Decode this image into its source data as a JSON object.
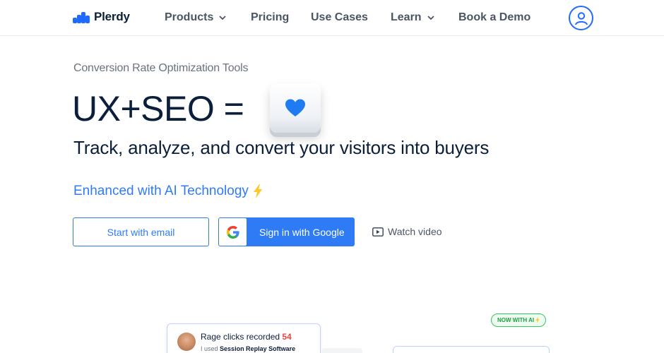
{
  "header": {
    "logo_text": "Plerdy",
    "nav": [
      {
        "label": "Products",
        "has_dropdown": true
      },
      {
        "label": "Pricing",
        "has_dropdown": false
      },
      {
        "label": "Use Cases",
        "has_dropdown": false
      },
      {
        "label": "Learn",
        "has_dropdown": true
      },
      {
        "label": "Book a Demo",
        "has_dropdown": false
      }
    ],
    "account_icon": "user-circle-icon"
  },
  "hero": {
    "eyebrow": "Conversion Rate Optimization Tools",
    "headline": "UX+SEO =",
    "headline_icon": "heart-keycap-icon",
    "subhead": "Track, analyze, and convert your visitors into buyers",
    "ai_text": "Enhanced with AI Technology",
    "ai_icon": "lightning-icon"
  },
  "cta": {
    "email_label": "Start with email",
    "google_label": "Sign in with Google",
    "watch_label": "Watch video"
  },
  "preview": {
    "badge": "NOW WITH AI",
    "rage_title": "Rage clicks recorded",
    "rage_count": "54",
    "rage_sub_prefix": "I used",
    "rage_sub_bold": "Session Replay Software"
  },
  "colors": {
    "accent": "#2f7bf6",
    "brand": "#1f6bff",
    "text": "#0b1f3a",
    "alert": "#ef4444",
    "ai_badge": "#34c759"
  }
}
